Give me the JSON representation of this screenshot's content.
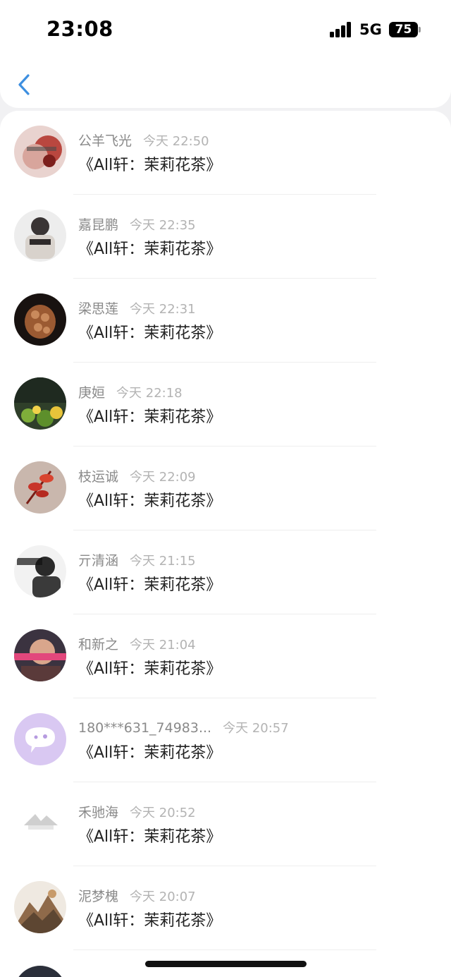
{
  "status_bar": {
    "time": "23:08",
    "network": "5G",
    "battery": "75"
  },
  "nav": {
    "back_icon": "chevron-left-icon"
  },
  "comments": [
    {
      "name": "公羊飞光",
      "time": "今天 22:50",
      "message": "《All轩：茉莉花茶》"
    },
    {
      "name": "嘉昆鹏",
      "time": "今天 22:35",
      "message": "《All轩：茉莉花茶》"
    },
    {
      "name": "梁思莲",
      "time": "今天 22:31",
      "message": "《All轩：茉莉花茶》"
    },
    {
      "name": "庚姮",
      "time": "今天 22:18",
      "message": "《All轩：茉莉花茶》"
    },
    {
      "name": "枝运诚",
      "time": "今天 22:09",
      "message": "《All轩：茉莉花茶》"
    },
    {
      "name": "亓清涵",
      "time": "今天 21:15",
      "message": "《All轩：茉莉花茶》"
    },
    {
      "name": "和新之",
      "time": "今天 21:04",
      "message": "《All轩：茉莉花茶》"
    },
    {
      "name": "180***631_74983...",
      "time": "今天 20:57",
      "message": "《All轩：茉莉花茶》"
    },
    {
      "name": "禾驰海",
      "time": "今天 20:52",
      "message": "《All轩：茉莉花茶》"
    },
    {
      "name": "泥梦槐",
      "time": "今天 20:07",
      "message": "《All轩：茉莉花茶》"
    }
  ],
  "colors": {
    "accent": "#3d8fe0",
    "name_text": "#8a8a8a",
    "time_text": "#b3b3b3",
    "message_text": "#222222"
  }
}
